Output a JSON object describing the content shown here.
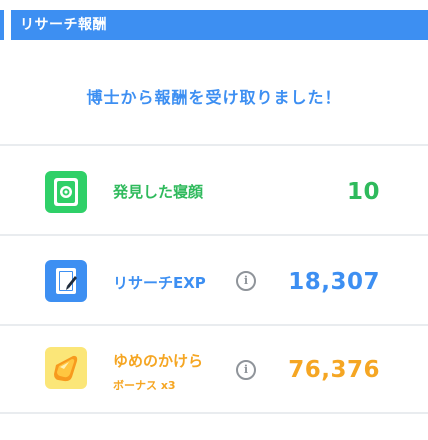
{
  "header": {
    "title": "リサーチ報酬"
  },
  "message": "博士から報酬を受け取りました！",
  "rewards": [
    {
      "label": "発見した寝顔",
      "value": "10",
      "icon": "photo-album-icon",
      "color": "#2fba5c"
    },
    {
      "label": "リサーチEXP",
      "value": "18,307",
      "icon": "research-notebook-icon",
      "info_icon": "i",
      "color": "#3d8ff2"
    },
    {
      "label": "ゆめのかけら",
      "sublabel": "ボーナス x3",
      "value": "76,376",
      "icon": "dream-shard-icon",
      "info_icon": "i",
      "color": "#f5a623"
    }
  ],
  "colors": {
    "header_bg": "#3d8ff2",
    "divider": "#e9ecef"
  }
}
